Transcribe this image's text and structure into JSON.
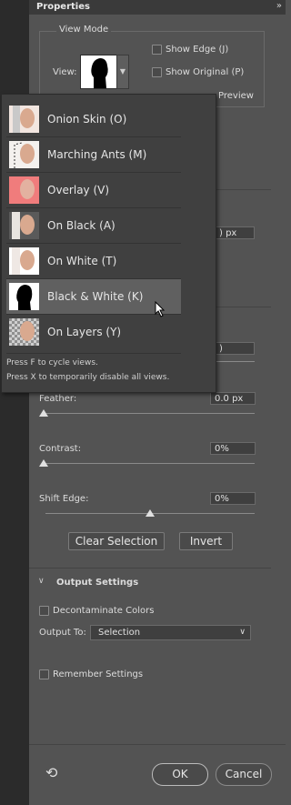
{
  "panel": {
    "title": "Properties"
  },
  "view_mode": {
    "title": "View Mode",
    "view_label": "View:",
    "show_edge": "Show Edge (J)",
    "show_original": "Show Original (P)",
    "preview": "Preview"
  },
  "dropdown": {
    "items": [
      {
        "label": "Onion Skin (O)",
        "thumb": "onion"
      },
      {
        "label": "Marching Ants (M)",
        "thumb": "ants"
      },
      {
        "label": "Overlay (V)",
        "thumb": "overlay"
      },
      {
        "label": "On Black (A)",
        "thumb": "black"
      },
      {
        "label": "On White (T)",
        "thumb": "white"
      },
      {
        "label": "Black & White (K)",
        "thumb": "bw"
      },
      {
        "label": "On Layers (Y)",
        "thumb": "layers"
      }
    ],
    "selected_index": 5,
    "hint1": "Press F to cycle views.",
    "hint2": "Press X to temporarily disable all views."
  },
  "partial_values": {
    "radius_value": ") px",
    "smooth_value": ")"
  },
  "global": {
    "feather_label": "Feather:",
    "feather_value": "0.0 px",
    "contrast_label": "Contrast:",
    "contrast_value": "0%",
    "shift_label": "Shift Edge:",
    "shift_value": "0%",
    "clear_selection": "Clear Selection",
    "invert": "Invert"
  },
  "output": {
    "title": "Output Settings",
    "decontaminate": "Decontaminate Colors",
    "output_to_label": "Output To:",
    "output_to_value": "Selection"
  },
  "remember": "Remember Settings",
  "footer": {
    "ok": "OK",
    "cancel": "Cancel"
  }
}
